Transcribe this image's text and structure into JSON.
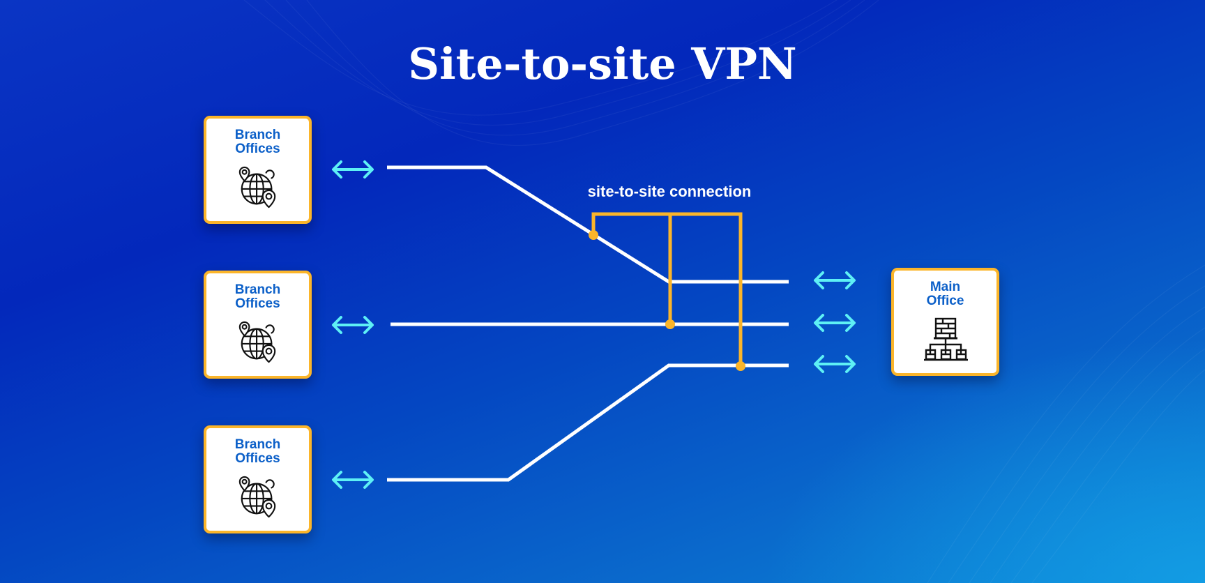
{
  "title": "Site-to-site VPN",
  "connection_label": "site-to-site connection",
  "branch_offices": [
    {
      "label_line1": "Branch",
      "label_line2": "Offices",
      "icon": "globe-location-icon"
    },
    {
      "label_line1": "Branch",
      "label_line2": "Offices",
      "icon": "globe-location-icon"
    },
    {
      "label_line1": "Branch",
      "label_line2": "Offices",
      "icon": "globe-location-icon"
    }
  ],
  "main_office": {
    "label_line1": "Main",
    "label_line2": "Office",
    "icon": "office-network-icon"
  },
  "connectors": {
    "type": "bidirectional-arrow",
    "count_left": 3,
    "count_right": 3
  },
  "colors": {
    "accent_orange": "#fbb52a",
    "arrow_cyan": "#5ef0f5",
    "label_blue": "#0b5fc8",
    "line_white": "#ffffff"
  }
}
